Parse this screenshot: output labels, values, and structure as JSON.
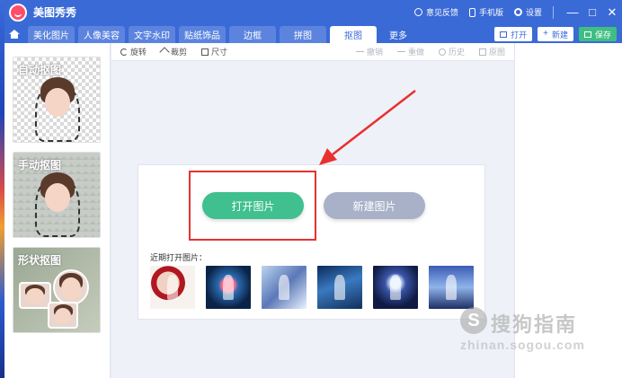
{
  "app": {
    "title": "美图秀秀"
  },
  "titlebar": {
    "feedback": "意见反馈",
    "phone": "手机版",
    "settings": "设置",
    "minimize": "—",
    "maximize": "□",
    "close": "✕"
  },
  "tabs": [
    {
      "label": "美化图片"
    },
    {
      "label": "人像美容"
    },
    {
      "label": "文字水印"
    },
    {
      "label": "贴纸饰品"
    },
    {
      "label": "边框"
    },
    {
      "label": "拼图"
    },
    {
      "label": "抠图"
    },
    {
      "label": "更多"
    }
  ],
  "active_tab": "抠图",
  "actions": {
    "open": "打开",
    "new": "新建",
    "save": "保存"
  },
  "toolbar": {
    "rotate": "旋转",
    "crop": "裁剪",
    "size": "尺寸",
    "undo": "撤销",
    "redo": "重做",
    "history": "历史",
    "original": "原图"
  },
  "sidebar": {
    "cards": [
      {
        "label": "自动抠图"
      },
      {
        "label": "手动抠图"
      },
      {
        "label": "形状抠图"
      }
    ]
  },
  "panel": {
    "open_button": "打开图片",
    "new_button": "新建图片",
    "recent_label": "近期打开图片："
  },
  "watermark": {
    "logo": "S",
    "text": "搜狗指南",
    "url": "zhinan.sogou.com"
  },
  "colors": {
    "brand": "#3a6ad6",
    "primary_green": "#3fc08e",
    "annotation_red": "#e8312f"
  }
}
